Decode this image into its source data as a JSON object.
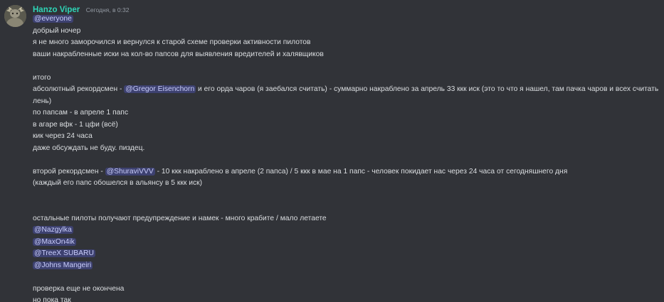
{
  "author": {
    "name": "Hanzo Viper",
    "timestamp": "Сегодня, в 0:32",
    "avatar_icon": "avatar-image"
  },
  "message": {
    "mention_everyone": "@everyone",
    "line_greeting": "добрый ночер",
    "line_intro_1": "я не много заморочился и вернулся к старой схеме проверки активности пилотов",
    "line_intro_2": "ваши накрабленные иски на кол-во папсов для выявления вредителей и халявщиков",
    "line_total": "итого",
    "record1_prefix": "абсолютный рекордсмен - ",
    "record1_mention": "@Gregor Eisenchorn",
    "record1_suffix": " и его орда чаров (я заебался считать) - суммарно накраблено за апрель 33 ккк иск (это то что я нашел, там пачка чаров и всех считать лень)",
    "record1_paps": "по папсам - в апреле 1 папс",
    "record1_agar": "в агаре вфк - 1 цфи (всё)",
    "record1_kick": "кик через 24 часа",
    "record1_discuss": "даже обсуждать не буду. пиздец.",
    "record2_prefix": "второй рекордсмен - ",
    "record2_mention": "@ShuraviVVV",
    "record2_suffix": " - 10 ккк накраблено в апреле (2 папса) / 5 ккк в мае на 1 папс - человек покидает нас через 24 часа от сегодняшнего дня",
    "record2_note": "(каждый его папс обошелся в альянсу в 5 ккк иск)",
    "others_line": "остальные пилоты получают предупреждение и намек - много крабите / мало летаете",
    "others_mentions": [
      "@Nazgylka",
      "@MaxOn4ik",
      "@TreeX SUBARU",
      "@Johns Mangeiri"
    ],
    "closing_1": "проверка еще не окончена",
    "closing_2": "но пока так"
  },
  "colors": {
    "background": "#313338",
    "username": "#2ed6b7",
    "text": "#dbdee1",
    "timestamp": "#949ba4",
    "mention_text": "#c9cdfb"
  }
}
